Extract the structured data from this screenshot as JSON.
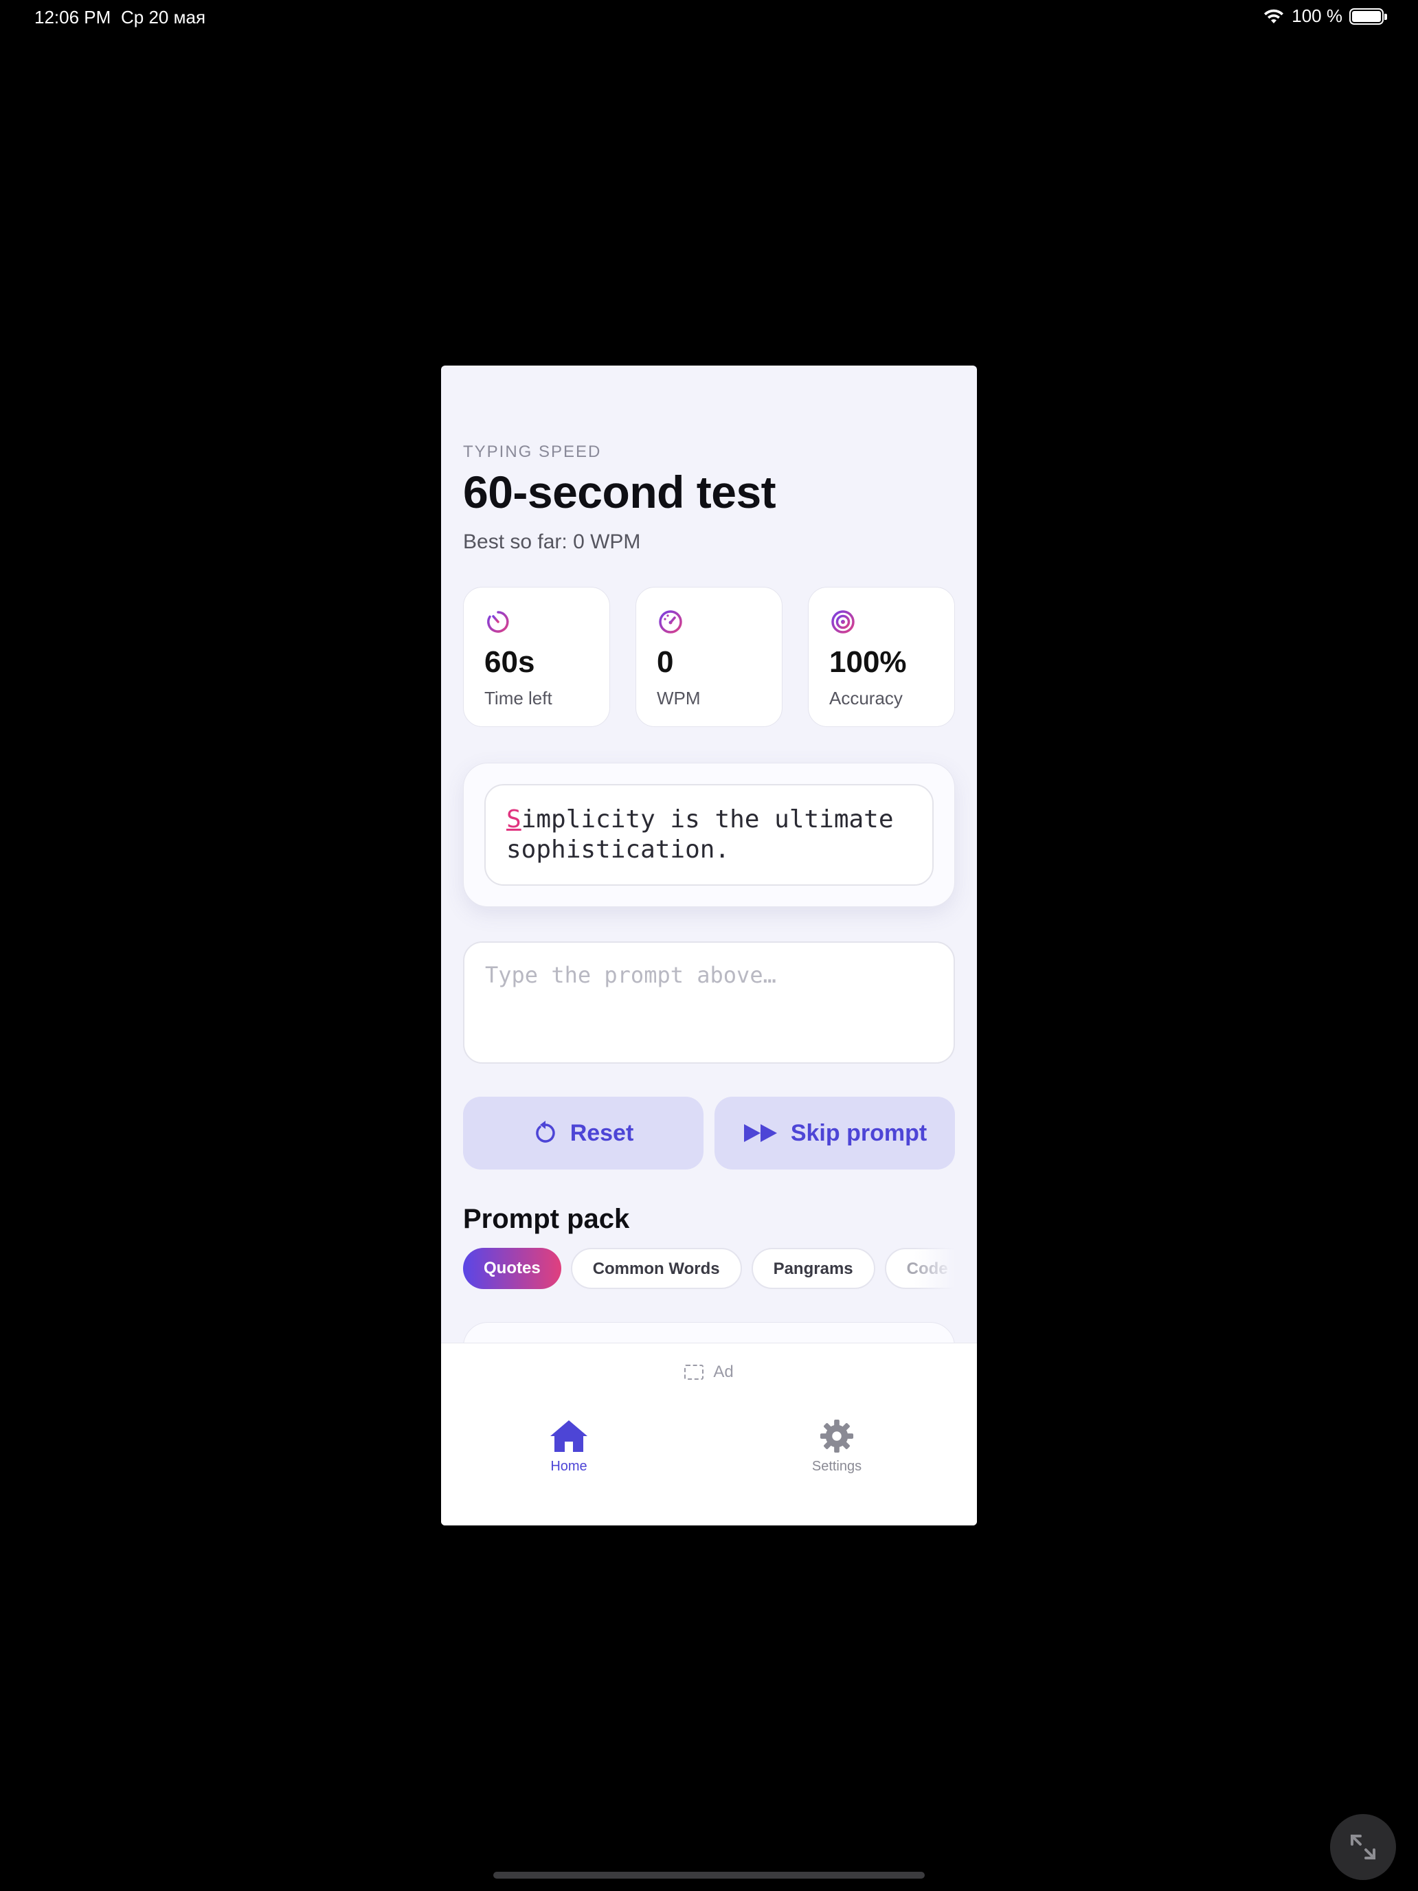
{
  "status_bar": {
    "time": "12:06 PM",
    "date": "Ср 20 мая",
    "battery_text": "100 %",
    "battery_level": 1.0
  },
  "header": {
    "eyebrow": "TYPING SPEED",
    "title": "60-second test",
    "subtitle": "Best so far: 0 WPM"
  },
  "stats": [
    {
      "icon": "timer-icon",
      "value": "60s",
      "label": "Time left"
    },
    {
      "icon": "speedometer-icon",
      "value": "0",
      "label": "WPM"
    },
    {
      "icon": "target-icon",
      "value": "100%",
      "label": "Accuracy"
    }
  ],
  "prompt": {
    "current_char": "S",
    "rest_line1": "implicity is the ultimate",
    "line2": "sophistication."
  },
  "input": {
    "placeholder": "Type the prompt above…"
  },
  "actions": {
    "reset_label": "Reset",
    "skip_label": "Skip prompt"
  },
  "prompt_pack": {
    "title": "Prompt pack",
    "chips": [
      "Quotes",
      "Common Words",
      "Pangrams",
      "Code"
    ],
    "selected": "Quotes"
  },
  "ad": {
    "label": "Ad"
  },
  "tabs": [
    {
      "label": "Home",
      "icon": "home-icon",
      "active": true
    },
    {
      "label": "Settings",
      "icon": "gear-icon",
      "active": false
    }
  ],
  "colors": {
    "accent": "#4d45d6",
    "gradient_start": "#5a46e6",
    "gradient_end": "#e0407e",
    "cursor_char": "#e0337f"
  }
}
